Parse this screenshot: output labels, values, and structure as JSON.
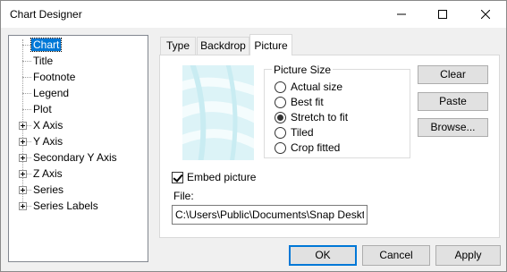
{
  "window": {
    "title": "Chart Designer"
  },
  "tree": {
    "items": [
      {
        "label": "Chart",
        "selected": true,
        "expandable": false
      },
      {
        "label": "Title",
        "expandable": false
      },
      {
        "label": "Footnote",
        "expandable": false
      },
      {
        "label": "Legend",
        "expandable": false
      },
      {
        "label": "Plot",
        "expandable": false
      },
      {
        "label": "X Axis",
        "expandable": true
      },
      {
        "label": "Y Axis",
        "expandable": true
      },
      {
        "label": "Secondary Y Axis",
        "expandable": true
      },
      {
        "label": "Z Axis",
        "expandable": true
      },
      {
        "label": "Series",
        "expandable": true
      },
      {
        "label": "Series Labels",
        "expandable": true
      }
    ]
  },
  "tabs": [
    {
      "label": "Type"
    },
    {
      "label": "Backdrop"
    },
    {
      "label": "Picture",
      "active": true
    }
  ],
  "picture": {
    "size_group_label": "Picture Size",
    "options": [
      {
        "label": "Actual size",
        "checked": false
      },
      {
        "label": "Best fit",
        "checked": false
      },
      {
        "label": "Stretch to fit",
        "checked": true
      },
      {
        "label": "Tiled",
        "checked": false
      },
      {
        "label": "Crop fitted",
        "checked": false
      }
    ],
    "clear_label": "Clear",
    "paste_label": "Paste",
    "browse_label": "Browse...",
    "embed_label": "Embed picture",
    "embed_checked": true,
    "file_label": "File:",
    "file_value": "C:\\Users\\Public\\Documents\\Snap Desktop\\"
  },
  "footer": {
    "ok_label": "OK",
    "cancel_label": "Cancel",
    "apply_label": "Apply"
  }
}
